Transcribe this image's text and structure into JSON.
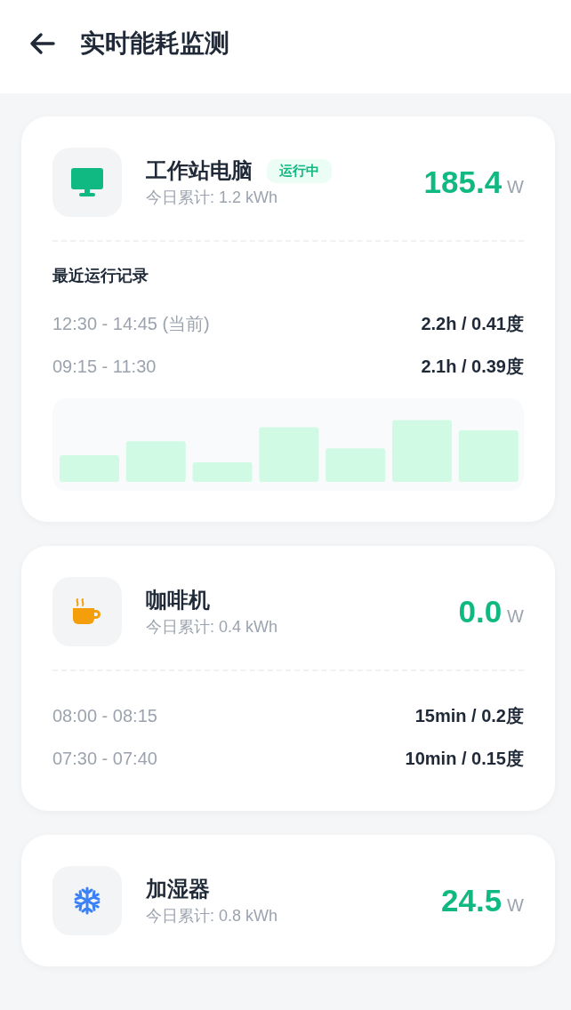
{
  "header": {
    "title": "实时能耗监测"
  },
  "devices": [
    {
      "name": "工作站电脑",
      "kind": "monitor",
      "status": "运行中",
      "today": "今日累计: 1.2 kWh",
      "power": "185.4",
      "unit": "W",
      "records_title": "最近运行记录",
      "records": [
        {
          "time": "12:30 - 14:45 (当前)",
          "usage": "2.2h / 0.41度"
        },
        {
          "time": "09:15 - 11:30",
          "usage": "2.1h / 0.39度"
        }
      ],
      "chart": {
        "kind": "picture"
      }
    },
    {
      "name": "咖啡机",
      "kind": "cup",
      "today": "今日累计: 0.4 kWh",
      "power": "0.0",
      "unit": "W",
      "records": [
        {
          "time": "08:00 - 08:15",
          "usage": "15min / 0.2度"
        },
        {
          "time": "07:30 - 07:40",
          "usage": "10min / 0.15度"
        }
      ]
    },
    {
      "name": "加湿器",
      "kind": "snowflake",
      "today": "今日累计: 0.8 kWh",
      "power": "24.5",
      "unit": "W"
    }
  ]
}
